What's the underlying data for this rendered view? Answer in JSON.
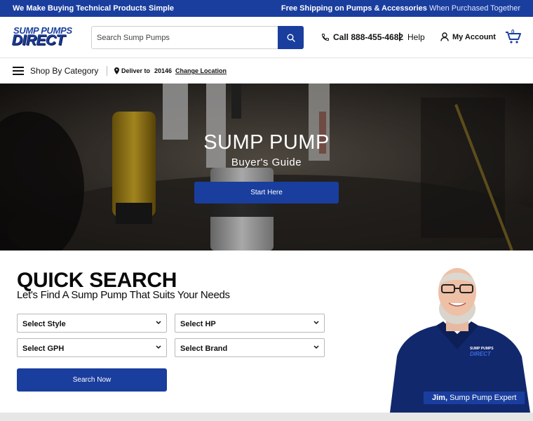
{
  "promo": {
    "left_text": "We Make Buying Technical Products Simple",
    "right_bold": "Free Shipping on Pumps & Accessories",
    "right_light": " When Purchased Together"
  },
  "header": {
    "logo_line1": "SUMP PUMPS",
    "logo_line2": "DIRECT",
    "search_placeholder": "Search Sump Pumps",
    "phone": "Call 888-455-4682",
    "separator": "|",
    "help": "Help",
    "account": "My Account",
    "cart_count": "0"
  },
  "nav": {
    "shop_label": "Shop By Category",
    "deliver_label": "Deliver to",
    "zip": "20146",
    "change_location": "Change Location"
  },
  "hero": {
    "title": "SUMP PUMP",
    "subtitle": "Buyer's Guide",
    "cta": "Start Here"
  },
  "quick_search": {
    "title": "QUICK SEARCH",
    "subtitle": "Let's Find A Sump Pump That Suits Your Needs",
    "selects": {
      "style": "Select Style",
      "hp": "Select HP",
      "gph": "Select GPH",
      "brand": "Select Brand"
    },
    "button": "Search Now"
  },
  "expert": {
    "name": "Jim,",
    "role": "Sump Pump Expert",
    "shirt_logo_line1": "SUMP PUMPS",
    "shirt_logo_line2": "DIRECT"
  },
  "colors": {
    "brand_blue": "#1a3e9e",
    "text": "#111111"
  }
}
